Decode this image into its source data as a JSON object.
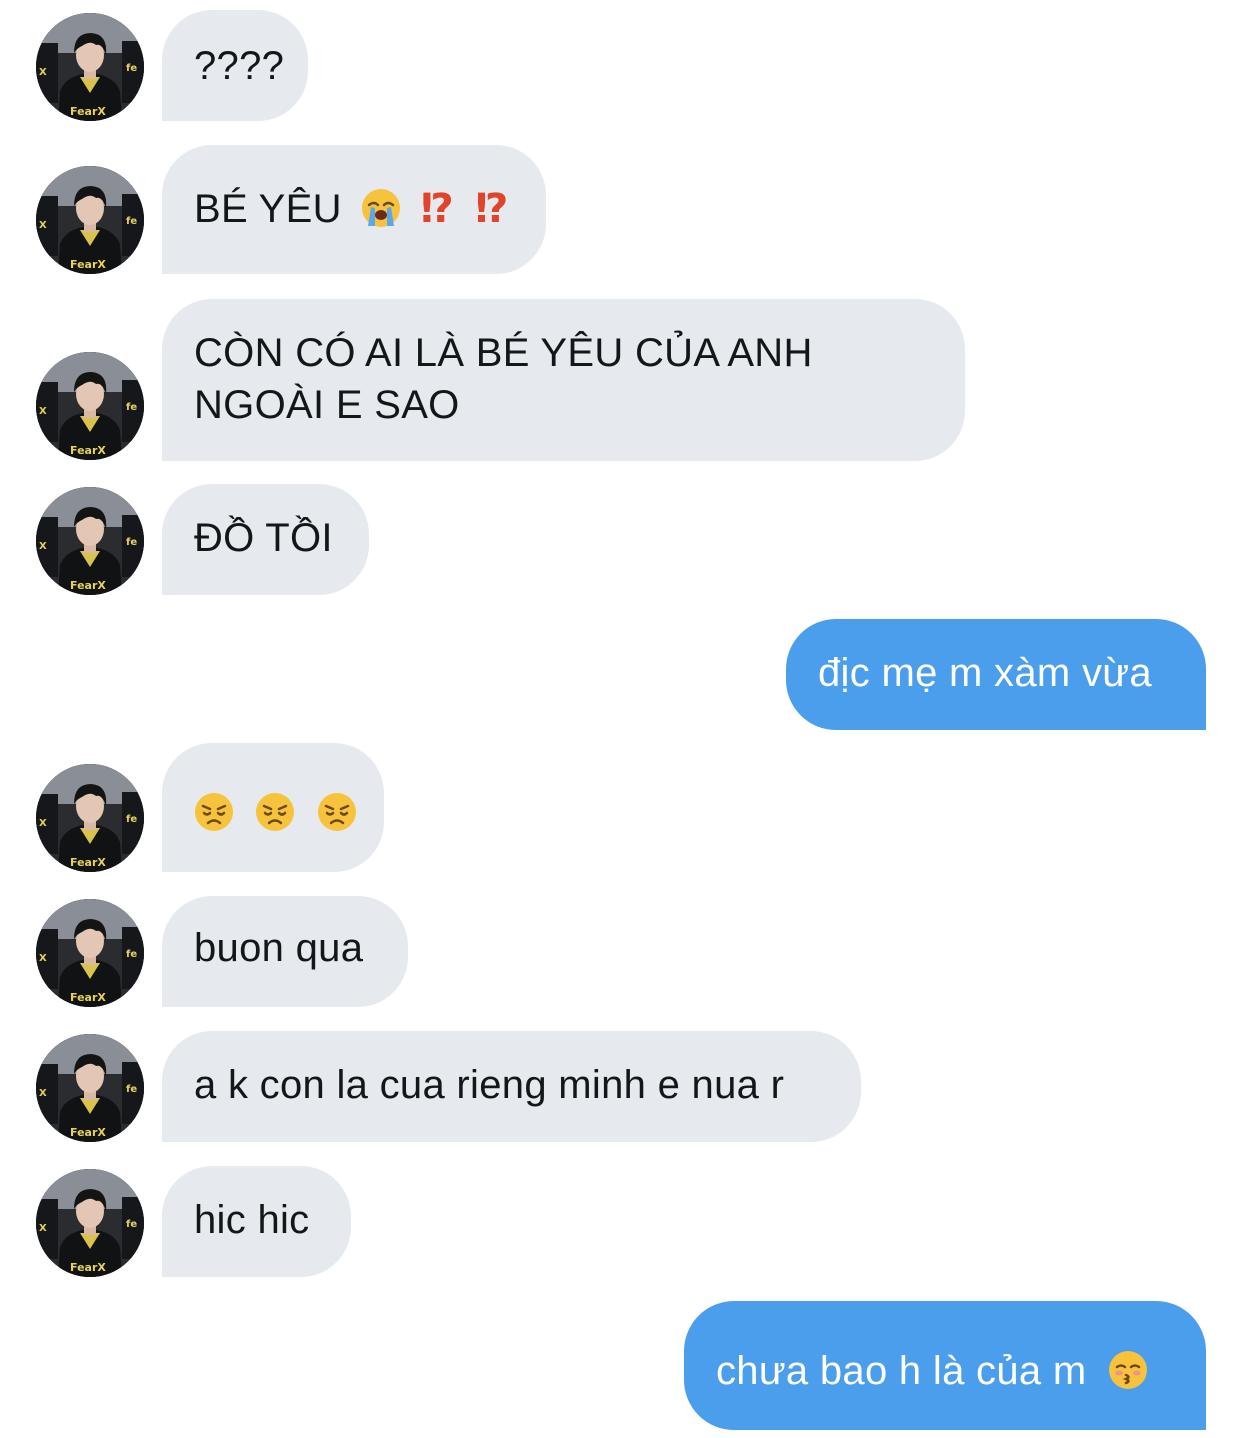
{
  "messages": [
    {
      "side": "in",
      "text": "????"
    },
    {
      "side": "in",
      "text": "BÉ YÊU",
      "emoji": "loudly-crying-face-icon",
      "extra": [
        "⁉",
        "⁉"
      ]
    },
    {
      "side": "in",
      "lines": [
        "CÒN CÓ AI LÀ BÉ YÊU CỦA ANH",
        "NGOÀI E SAO"
      ]
    },
    {
      "side": "in",
      "text": "ĐỒ TỒI"
    },
    {
      "side": "out",
      "text": "địc mẹ m xàm vừa"
    },
    {
      "side": "in",
      "emojis": [
        "disappointed-face-icon",
        "disappointed-face-icon",
        "disappointed-face-icon"
      ]
    },
    {
      "side": "in",
      "text": "buon qua"
    },
    {
      "side": "in",
      "text": "a k con la cua rieng minh e nua r"
    },
    {
      "side": "in",
      "text": "hic hic"
    },
    {
      "side": "out",
      "text": "chưa bao h là của m",
      "emoji": "kissing-face-with-closed-eyes-icon"
    }
  ],
  "colors": {
    "incoming_bubble": "#e6e9ee",
    "outgoing_bubble": "#4a9eeb",
    "incoming_text": "#14171a",
    "outgoing_text": "#ffffff",
    "emoji_yellow": "#f7c23c"
  }
}
